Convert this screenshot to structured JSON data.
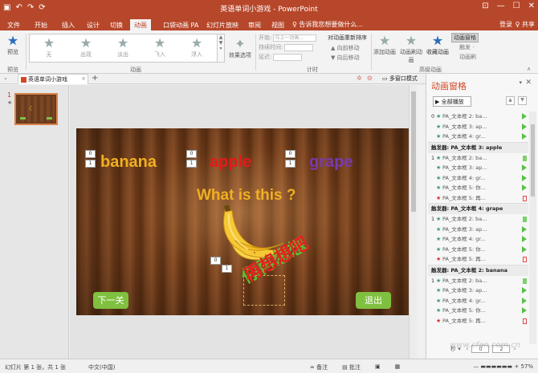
{
  "window": {
    "title": "英语单词小游戏 - PowerPoint",
    "minimize": "—",
    "restore": "☐",
    "close": "✕"
  },
  "qat": {
    "undo": "↶",
    "redo": "↷",
    "repeat": "⟳"
  },
  "ribbon_tabs": [
    "文件",
    "开始",
    "插入",
    "设计",
    "切换",
    "动画",
    "口袋动画 PA",
    "幻灯片放映",
    "审阅",
    "视图"
  ],
  "active_tab": "动画",
  "tell_me": "♀ 告诉我您想要做什么...",
  "account": {
    "login": "登录",
    "share": "♀ 共享"
  },
  "ribbon": {
    "preview": {
      "label": "预览",
      "group": "预览"
    },
    "gallery": {
      "items": [
        "无",
        "出现",
        "淡出",
        "飞入",
        "浮入"
      ],
      "group": "动画"
    },
    "effect_options": "效果选项",
    "timing": {
      "start_label": "开始:",
      "start_value": "与上一动画...",
      "duration_label": "持续时间:",
      "delay_label": "延迟:",
      "reorder_title": "对动画重新排序",
      "move_earlier": "▲ 向前移动",
      "move_later": "▼ 向后移动",
      "group": "计时"
    },
    "advanced": {
      "add_animation": "添加动画",
      "painter": "动画刷动画",
      "favorite": "收藏动画",
      "pane_button": "动画窗格",
      "trigger": "触发 ·",
      "anim_brush": "动画刷",
      "group": "高级动画"
    }
  },
  "doc_tab": {
    "name": "英语单词小游戏",
    "close": "×",
    "add": "+"
  },
  "multi_window": "多窗口模式",
  "thumbnail": {
    "number": "1",
    "star": "★"
  },
  "slide": {
    "words": [
      "banana",
      "apple",
      "grape"
    ],
    "question": "What is this ?",
    "btn_next": "下一关",
    "btn_exit": "退出",
    "retry": "再想想吧",
    "retry_green": "你再想想",
    "tag_digits": [
      "0",
      "1"
    ]
  },
  "animation_pane": {
    "title": "动画窗格",
    "play_all": "▶ 全部播放",
    "groups": [
      {
        "header": "",
        "rows": [
          {
            "num": "0",
            "icon": "★",
            "text": "PA_文本框 2: ba...",
            "bar": "gp"
          },
          {
            "num": "",
            "icon": "★",
            "text": "PA_文本框 3: ap...",
            "bar": "gp"
          },
          {
            "num": "",
            "icon": "★",
            "text": "PA_文本框 4: gr...",
            "bar": "gp"
          }
        ]
      },
      {
        "header": "触发器: PA_文本框 3: apple",
        "rows": [
          {
            "num": "1",
            "icon": "★",
            "text": "PA_文本框 2: ba...",
            "bar": "g"
          },
          {
            "num": "",
            "icon": "★",
            "text": "PA_文本框 3: ap...",
            "bar": "gp"
          },
          {
            "num": "",
            "icon": "★",
            "text": "PA_文本框 4: gr...",
            "bar": "gp"
          },
          {
            "num": "",
            "icon": "★",
            "text": "PA_文本框 5: 你...",
            "bar": "gp"
          },
          {
            "num": "",
            "icon": "★",
            "text": "PA_文本框 5: 再...",
            "bar": "r",
            "red": true
          }
        ]
      },
      {
        "header": "触发器: PA_文本框 4: grape",
        "rows": [
          {
            "num": "1",
            "icon": "★",
            "text": "PA_文本框 2: ba...",
            "bar": "g"
          },
          {
            "num": "",
            "icon": "★",
            "text": "PA_文本框 3: ap...",
            "bar": "gp"
          },
          {
            "num": "",
            "icon": "★",
            "text": "PA_文本框 4: gr...",
            "bar": "gp"
          },
          {
            "num": "",
            "icon": "★",
            "text": "PA_文本框 5: 你...",
            "bar": "gp"
          },
          {
            "num": "",
            "icon": "★",
            "text": "PA_文本框 5: 再...",
            "bar": "r",
            "red": true
          }
        ]
      },
      {
        "header": "触发器: PA_文本框 2: banana",
        "rows": [
          {
            "num": "1",
            "icon": "★",
            "text": "PA_文本框 2: ba...",
            "bar": "g"
          },
          {
            "num": "",
            "icon": "★",
            "text": "PA_文本框 3: ap...",
            "bar": "gp"
          },
          {
            "num": "",
            "icon": "★",
            "text": "PA_文本框 4: gr...",
            "bar": "gp"
          },
          {
            "num": "",
            "icon": "★",
            "text": "PA_文本框 5: 你...",
            "bar": "gp"
          },
          {
            "num": "",
            "icon": "★",
            "text": "PA_文本框 5: 再...",
            "bar": "r",
            "red": true
          }
        ]
      }
    ],
    "footer": {
      "seconds": "秒 ▾",
      "page": "0",
      "pages": "2"
    }
  },
  "statusbar": {
    "slide_info": "幻灯片 第 1 张，共 1 张",
    "language": "中文(中国)",
    "notes": "≐ 备注",
    "comments": "▤ 批注",
    "zoom": "57%"
  },
  "watermark": "www.cfan.com.cn"
}
